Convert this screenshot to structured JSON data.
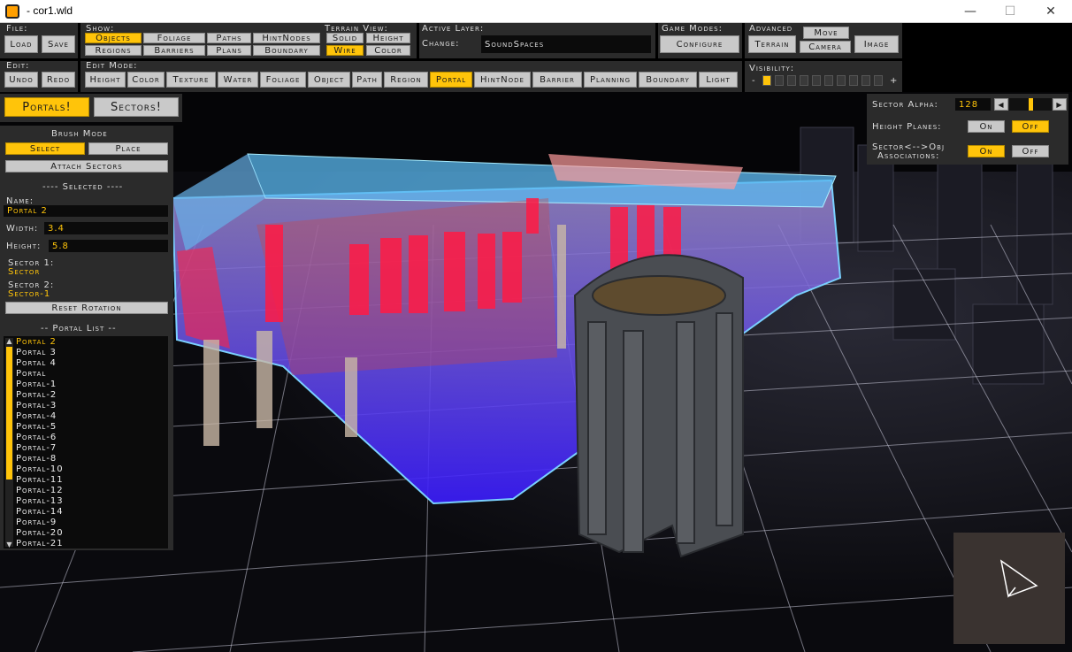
{
  "window": {
    "title": "- cor1.wld",
    "minimize": "—",
    "maximize": "☐",
    "close": "✕"
  },
  "toolbar": {
    "file_label": "File:",
    "load": "Load",
    "save": "Save",
    "show_label": "Show:",
    "show": [
      "Objects",
      "Foliage",
      "Paths",
      "HintNodes",
      "Regions",
      "Barriers",
      "Plans",
      "Boundary"
    ],
    "terrain_view_label": "Terrain View:",
    "terrain_view": [
      "Solid",
      "Height",
      "Wire",
      "Color"
    ],
    "active_layer_label": "Active Layer:",
    "change_label": "Change:",
    "active_layer_value": "SoundSpaces",
    "game_modes_label": "Game Modes:",
    "configure": "Configure",
    "advanced_label": "Advanced",
    "move": "Move",
    "terrain": "Terrain",
    "camera": "Camera",
    "image": "Image",
    "edit_label": "Edit:",
    "undo": "Undo",
    "redo": "Redo",
    "edit_mode_label": "Edit Mode:",
    "edit_modes": [
      "Height",
      "Color",
      "Texture",
      "Water",
      "Foliage",
      "Object",
      "Path",
      "Region",
      "Portal",
      "HintNode",
      "Barrier",
      "Planning",
      "Boundary",
      "Light"
    ],
    "visibility_label": "Visibility:",
    "visibility_minus": "-",
    "visibility_plus": "+",
    "visibility_level": 1,
    "visibility_steps": 10
  },
  "tabs": {
    "portals": "Portals!",
    "sectors": "Sectors!"
  },
  "left_panel": {
    "brush_mode_label": "Brush Mode",
    "select": "Select",
    "place": "Place",
    "attach_sectors": "Attach Sectors",
    "selected_label": "---- Selected ----",
    "name_label": "Name:",
    "name_value": "Portal 2",
    "width_label": "Width:",
    "width_value": "3.4",
    "height_label": "Height:",
    "height_value": "5.8",
    "sector1_label": "Sector 1:",
    "sector1_value": "Sector",
    "sector2_label": "Sector 2:",
    "sector2_value": "Sector-1",
    "reset_rotation": "Reset Rotation",
    "portal_list_label": "-- Portal List --",
    "portal_list": [
      "Portal 2",
      "Portal 3",
      "Portal 4",
      "Portal",
      "Portal-1",
      "Portal-2",
      "Portal-3",
      "Portal-4",
      "Portal-5",
      "Portal-6",
      "Portal-7",
      "Portal-8",
      "Portal-10",
      "Portal-11",
      "Portal-12",
      "Portal-13",
      "Portal-14",
      "Portal-9",
      "Portal-20",
      "Portal-21"
    ],
    "scroll_up": "▲",
    "scroll_down": "▼"
  },
  "right_panel": {
    "sector_alpha_label": "Sector Alpha:",
    "sector_alpha_value": "128",
    "sector_alpha_fraction": 0.5,
    "height_planes_label": "Height Planes:",
    "on": "On",
    "off": "Off",
    "assoc_label_1": "Sector<-->Obj",
    "assoc_label_2": "Associations:",
    "arrow_left": "◀",
    "arrow_right": "▶"
  },
  "colors": {
    "accent": "#ffc40a",
    "button": "#c9c9c9",
    "panel": "#2b2b2b"
  }
}
